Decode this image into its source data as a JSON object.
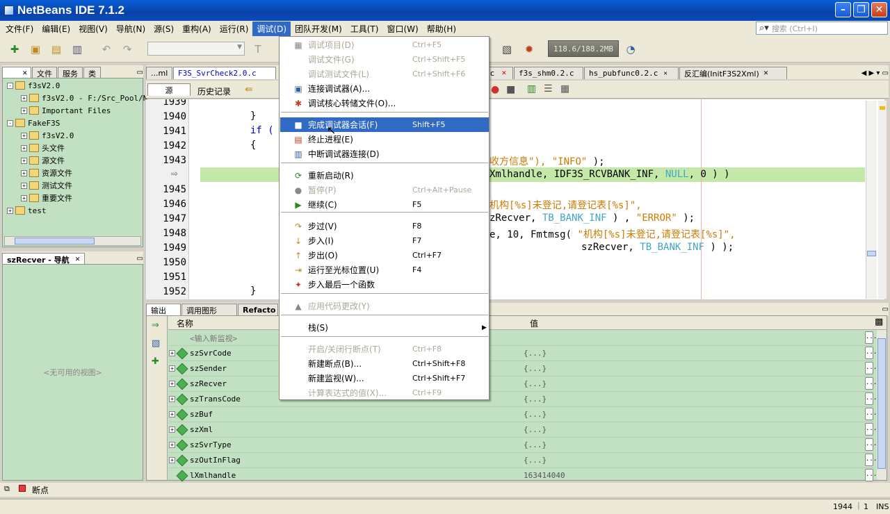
{
  "window": {
    "title": "NetBeans IDE 7.1.2",
    "min": "–",
    "max": "❐",
    "close": "✕"
  },
  "menubar": [
    "文件(F)",
    "编辑(E)",
    "视图(V)",
    "导航(N)",
    "源(S)",
    "重构(A)",
    "运行(R)",
    "调试(D)",
    "团队开发(M)",
    "工具(T)",
    "窗口(W)",
    "帮助(H)"
  ],
  "search": {
    "placeholder": "搜索 (Ctrl+I)"
  },
  "toolbar": {
    "memory": "118.6/188.2MB"
  },
  "projects_panel": {
    "tabs": [
      "文件",
      "服务",
      "类"
    ],
    "tree": [
      {
        "label": "f3sV2.0",
        "depth": 0,
        "exp": "-"
      },
      {
        "label": "f3sV2.0 - F:/Src_Pool/N",
        "depth": 1,
        "exp": "+"
      },
      {
        "label": "Important Files",
        "depth": 1,
        "exp": "+"
      },
      {
        "label": "FakeF3S",
        "depth": 0,
        "exp": "-"
      },
      {
        "label": "f3sV2.0",
        "depth": 1,
        "exp": "+"
      },
      {
        "label": "头文件",
        "depth": 1,
        "exp": "+"
      },
      {
        "label": "源文件",
        "depth": 1,
        "exp": "+"
      },
      {
        "label": "资源文件",
        "depth": 1,
        "exp": "+"
      },
      {
        "label": "测试文件",
        "depth": 1,
        "exp": "+"
      },
      {
        "label": "重要文件",
        "depth": 1,
        "exp": "+"
      },
      {
        "label": "test",
        "depth": 0,
        "exp": "+"
      }
    ]
  },
  "navigator": {
    "title": "szRecver - 导航",
    "empty": "<无可用的视图>"
  },
  "editor_tabs": [
    "...ml",
    "F3S_SvrCheck2.0.c",
    "c",
    "f3s_shm0.2.c",
    "hs_pubfunc0.2.c",
    "反汇编(InitF3S2Xml)"
  ],
  "editor_subtabs": {
    "source": "源",
    "history": "历史记录"
  },
  "code": {
    "lines": [
      "1939",
      "1940",
      "1941",
      "1942",
      "1943",
      "",
      "1945",
      "1946",
      "1947",
      "1948",
      "1949",
      "1950",
      "1951",
      "1952"
    ],
    "c1939": "}",
    "c1940": "}",
    "c1941": "if (",
    "c1942": "{",
    "c1943_a": "收方信息\"),",
    "c1943_b": "\"INFO\"",
    "c1943_c": ");",
    "c1944_a": "Xmlhandle, IDF3S_RCVBANK_INF,",
    "c1944_b": "NULL",
    "c1944_c": ", 0 ) )",
    "c1946": "机构[%s]未登记,请登记表[%s]\",",
    "c1947_a": "zRecver,",
    "c1947_b": "TB_BANK_INF",
    "c1947_c": ") ,",
    "c1947_d": "\"ERROR\"",
    "c1947_e": ");",
    "c1948_a": "e, 10, Fmtmsg(",
    "c1948_b": "\"机构[%s]未登记,请登记表[%s]\",",
    "c1949_a": "szRecver,",
    "c1949_b": "TB_BANK_INF",
    "c1949_c": ") );",
    "c1952": "}"
  },
  "bottom_tabs": [
    "输出",
    "调用图形",
    "Refacto"
  ],
  "watches": {
    "col_name": "名称",
    "col_value": "值",
    "new": "<输入新监视>",
    "rows": [
      {
        "name": "szSvrCode",
        "value": "{...}"
      },
      {
        "name": "szSender",
        "value": "{...}"
      },
      {
        "name": "szRecver",
        "value": "{...}"
      },
      {
        "name": "szTransCode",
        "value": "{...}"
      },
      {
        "name": "szBuf",
        "value": "{...}"
      },
      {
        "name": "szXml",
        "value": "{...}"
      },
      {
        "name": "szSvrType",
        "value": "{...}"
      },
      {
        "name": "szOutInFlag",
        "value": "{...}"
      },
      {
        "name": "lXmlhandle",
        "value": "163414040"
      }
    ],
    "dots": "..."
  },
  "debug_menu": [
    {
      "label": "调试项目(D)",
      "sc": "Ctrl+F5",
      "dis": true,
      "icon": "▦"
    },
    {
      "label": "调试文件(G)",
      "sc": "Ctrl+Shift+F5",
      "dis": true,
      "icon": ""
    },
    {
      "label": "调试测试文件(L)",
      "sc": "Ctrl+Shift+F6",
      "dis": true,
      "icon": ""
    },
    {
      "label": "连接调试器(A)...",
      "sc": "",
      "icon": "▣"
    },
    {
      "label": "调试核心转储文件(O)...",
      "sc": "",
      "icon": "✱"
    },
    {
      "label": "完成调试器会话(F)",
      "sc": "Shift+F5",
      "hl": true,
      "icon": "■"
    },
    {
      "label": "终止进程(E)",
      "sc": "",
      "icon": "▤"
    },
    {
      "label": "中断调试器连接(D)",
      "sc": "",
      "icon": "▥"
    },
    {
      "label": "重新启动(R)",
      "sc": "",
      "icon": "⟳"
    },
    {
      "label": "暂停(P)",
      "sc": "Ctrl+Alt+Pause",
      "dis": true,
      "icon": "●"
    },
    {
      "label": "继续(C)",
      "sc": "F5",
      "icon": "▶"
    },
    {
      "label": "步过(V)",
      "sc": "F8",
      "icon": "↷"
    },
    {
      "label": "步入(I)",
      "sc": "F7",
      "icon": "↓"
    },
    {
      "label": "步出(O)",
      "sc": "Ctrl+F7",
      "icon": "↑"
    },
    {
      "label": "运行至光标位置(U)",
      "sc": "F4",
      "icon": "⇥"
    },
    {
      "label": "步入最后一个函数",
      "sc": "",
      "icon": "✦"
    },
    {
      "label": "应用代码更改(Y)",
      "sc": "",
      "dis": true,
      "icon": "▲"
    },
    {
      "label": "栈(S)",
      "sc": "▶",
      "icon": ""
    },
    {
      "label": "开启/关闭行断点(T)",
      "sc": "Ctrl+F8",
      "dis": true,
      "icon": ""
    },
    {
      "label": "新建断点(B)...",
      "sc": "Ctrl+Shift+F8",
      "icon": ""
    },
    {
      "label": "新建监视(W)...",
      "sc": "Ctrl+Shift+F7",
      "icon": ""
    },
    {
      "label": "计算表达式的值(X)...",
      "sc": "Ctrl+F9",
      "dis": true,
      "icon": ""
    }
  ],
  "statusbar": {
    "breakpoints": "断点",
    "line": "1944",
    "col": "1",
    "mode": "INS"
  }
}
